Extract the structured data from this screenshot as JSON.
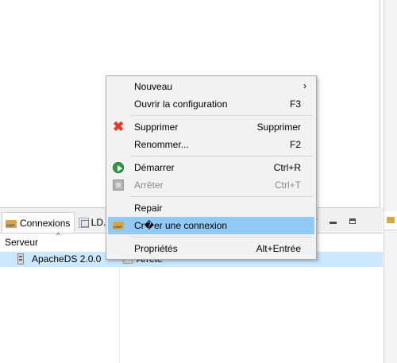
{
  "tabs": {
    "connexions_label": "Connexions",
    "ldap_label": "LD..."
  },
  "table": {
    "column_server": "Serveur",
    "sort_indicator": "^",
    "rows": [
      {
        "name": "ApacheDS 2.0.0",
        "state": "Arrêté"
      }
    ]
  },
  "context_menu": {
    "items": [
      {
        "label": "Nouveau",
        "shortcut": "",
        "submenu_arrow": "›"
      },
      {
        "label": "Ouvrir la configuration",
        "shortcut": "F3"
      },
      {
        "label": "Supprimer",
        "shortcut": "Supprimer",
        "icon": "delete-icon"
      },
      {
        "label": "Renommer...",
        "shortcut": "F2"
      },
      {
        "label": "Démarrer",
        "shortcut": "Ctrl+R",
        "icon": "start-icon"
      },
      {
        "label": "Arrêter",
        "shortcut": "Ctrl+T",
        "icon": "stop-icon",
        "disabled": true
      },
      {
        "label": "Repair",
        "shortcut": ""
      },
      {
        "label": "Cr�er une connexion",
        "shortcut": "",
        "icon": "ldap-connection-icon",
        "highlighted": true
      },
      {
        "label": "Propriétés",
        "shortcut": "Alt+Entrée"
      }
    ]
  },
  "colors": {
    "highlight": "#91c9f7",
    "row_selection": "#cce8ff",
    "menu_background": "#f2f2f2",
    "delete_red": "#e23b2b",
    "start_green": "#2f9e3e"
  }
}
